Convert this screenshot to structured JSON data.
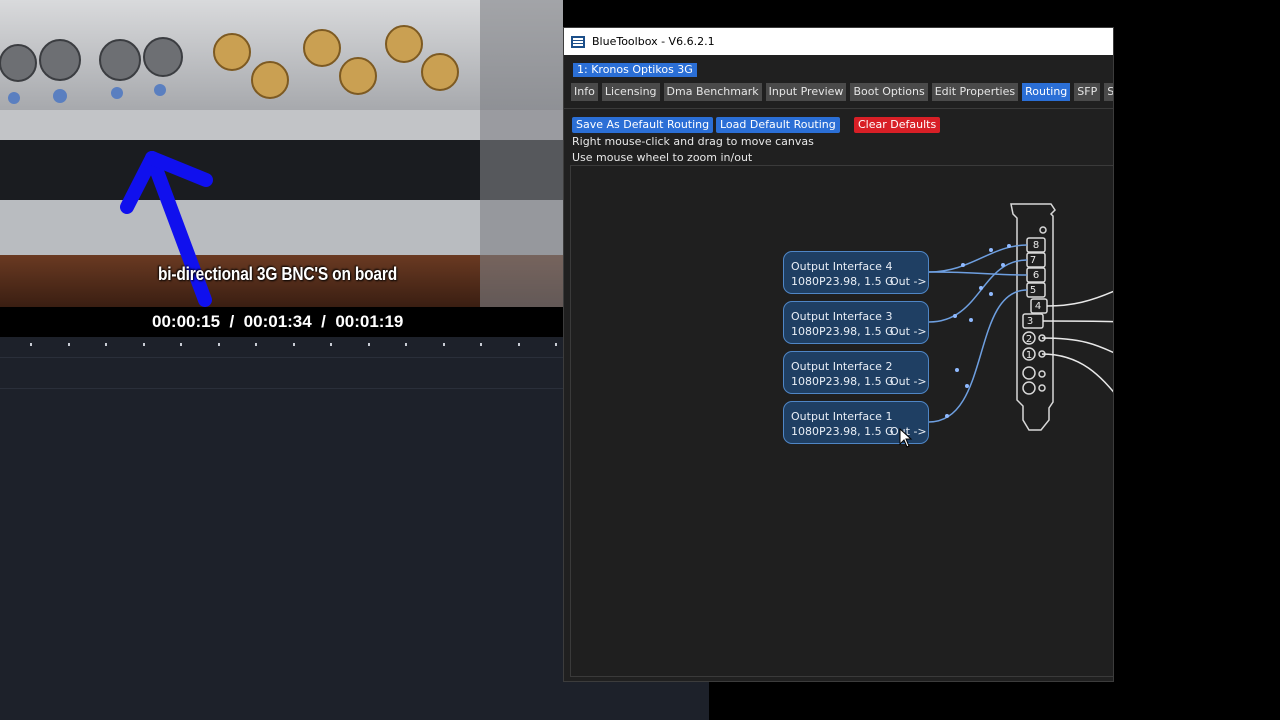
{
  "video": {
    "caption": "bi-directional 3G BNC'S on board",
    "timecode": "00:00:15  /  00:01:34  /  00:01:19"
  },
  "window": {
    "title": "BlueToolbox - V6.6.2.1",
    "device_tab": "1: Kronos Optikos 3G",
    "tabs": [
      "Info",
      "Licensing",
      "Dma Benchmark",
      "Input Preview",
      "Boot Options",
      "Edit Properties",
      "Routing",
      "SFP",
      "Simpl"
    ],
    "active_tab": "Routing",
    "buttons": {
      "save_default": "Save As Default Routing",
      "load_default": "Load Default Routing",
      "clear_defaults": "Clear Defaults"
    },
    "hints": [
      "Right mouse-click and drag to move canvas",
      "Use mouse wheel to zoom in/out"
    ],
    "nodes": [
      {
        "title": "Output Interface 4",
        "format": "1080P23.98, 1.5 G",
        "out": "Out ->"
      },
      {
        "title": "Output Interface 3",
        "format": "1080P23.98, 1.5 G",
        "out": "Out ->"
      },
      {
        "title": "Output Interface 2",
        "format": "1080P23.98, 1.5 G",
        "out": "Out ->"
      },
      {
        "title": "Output Interface 1",
        "format": "1080P23.98, 1.5 G",
        "out": "Out ->"
      }
    ],
    "card_ports": [
      "8",
      "7",
      "6",
      "5",
      "4",
      "3",
      "2",
      "1"
    ]
  },
  "colors": {
    "accent_blue": "#2b6fd6",
    "danger_red": "#d81f26",
    "node_fill": "#1f3f63",
    "arrow_blue": "#1010ee"
  }
}
